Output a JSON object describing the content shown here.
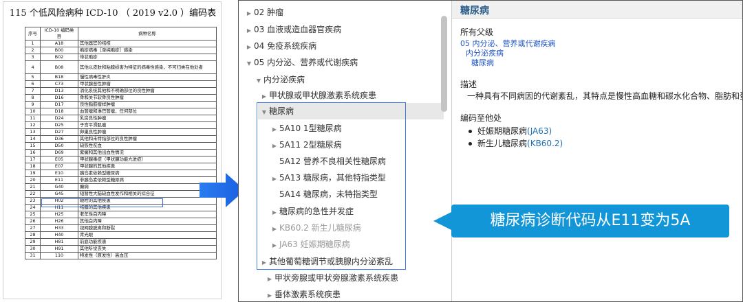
{
  "document": {
    "title": "115 个低风险病种 ICD-10 （ 2019 v2.0 ）编码表",
    "headers": {
      "no": "序号",
      "code": "ICD-10 编码类 目",
      "name": "病种名称"
    },
    "rows": [
      {
        "no": "1",
        "code": "A18",
        "name": "其他器官的结核"
      },
      {
        "no": "2",
        "code": "B00",
        "name": "疱疹病毒［单纯疱疹］感染"
      },
      {
        "no": "3",
        "code": "B02",
        "name": "带状疱疹"
      },
      {
        "no": "4",
        "code": "B08",
        "name": "其他以皮肤和粘膜损害为特征的病毒性感染，不可归类在他处者"
      },
      {
        "no": "5",
        "code": "B18",
        "name": "慢性病毒性肝炎"
      },
      {
        "no": "6",
        "code": "C73",
        "name": "甲状腺恶性肿瘤"
      },
      {
        "no": "7",
        "code": "D13",
        "name": "消化系统其他和不明确部位的良性肿瘤"
      },
      {
        "no": "8",
        "code": "D16",
        "name": "骨和关节软骨良性肿瘤"
      },
      {
        "no": "9",
        "code": "D17",
        "name": "良性脂肪瘤样肿瘤"
      },
      {
        "no": "10",
        "code": "D18",
        "name": "血管瘤和淋巴管瘤，任何部位"
      },
      {
        "no": "11",
        "code": "D24",
        "name": "乳房良性肿瘤"
      },
      {
        "no": "12",
        "code": "D25",
        "name": "子宫平滑肌瘤"
      },
      {
        "no": "13",
        "code": "D27",
        "name": "卵巢良性肿瘤"
      },
      {
        "no": "14",
        "code": "D36",
        "name": "其他和未特指部位的良性肿瘤"
      },
      {
        "no": "15",
        "code": "D50",
        "name": "缺铁性贫血"
      },
      {
        "no": "16",
        "code": "D69",
        "name": "紫癜和其他出血性情况"
      },
      {
        "no": "17",
        "code": "E05",
        "name": "甲状腺毒症（甲状腺功能亢进症）"
      },
      {
        "no": "18",
        "code": "E07",
        "name": "甲状腺的其他疾患"
      },
      {
        "no": "19",
        "code": "E10",
        "name": "胰岛素依赖型糖尿病"
      },
      {
        "no": "20",
        "code": "E11",
        "name": "非胰岛素依赖型糖尿病"
      },
      {
        "no": "21",
        "code": "G40",
        "name": "癫痫"
      },
      {
        "no": "22",
        "code": "G45",
        "name": "短暂性大脑缺血性发作和相关的综合征"
      },
      {
        "no": "23",
        "code": "H02",
        "name": "眼睑的其他疾患"
      },
      {
        "no": "24",
        "code": "H11",
        "name": "结膜的其他疾患"
      },
      {
        "no": "25",
        "code": "H25",
        "name": "老年性白内障"
      },
      {
        "no": "26",
        "code": "H26",
        "name": "其他白内障"
      },
      {
        "no": "27",
        "code": "H33",
        "name": "视网膜脱离和断裂"
      },
      {
        "no": "28",
        "code": "H40",
        "name": "青光眼"
      },
      {
        "no": "29",
        "code": "H81",
        "name": "前庭功能疾患"
      },
      {
        "no": "30",
        "code": "H91",
        "name": "其他听觉丧失"
      },
      {
        "no": "31",
        "code": "110",
        "name": "特发性（原发性）高血压"
      }
    ]
  },
  "tree": {
    "items": [
      {
        "label": "02 肿瘤",
        "toggle": "collapsed"
      },
      {
        "label": "03 血液或造血器官疾病",
        "toggle": "collapsed"
      },
      {
        "label": "04 免疫系统疾病",
        "toggle": "collapsed"
      },
      {
        "label": "05 内分泌、营养或代谢疾病",
        "toggle": "expanded"
      },
      {
        "label": "内分泌疾病",
        "toggle": "expanded"
      },
      {
        "label": "甲状腺或甲状腺激素系统疾患",
        "toggle": "collapsed"
      },
      {
        "label": "糖尿病",
        "toggle": "expanded"
      },
      {
        "label": "5A10 1型糖尿病",
        "toggle": "collapsed"
      },
      {
        "label": "5A11 2型糖尿病",
        "toggle": "collapsed"
      },
      {
        "label": "5A12 营养不良相关性糖尿病",
        "toggle": "none"
      },
      {
        "label": "5A13 糖尿病，其他特指类型",
        "toggle": "collapsed"
      },
      {
        "label": "5A14 糖尿病，未特指类型",
        "toggle": "none"
      },
      {
        "label": "糖尿病的急性并发症",
        "toggle": "collapsed"
      },
      {
        "label": "KB60.2 新生儿糖尿病",
        "toggle": "collapsed"
      },
      {
        "label": "JA63 妊娠期糖尿病",
        "toggle": "collapsed"
      },
      {
        "label": "其他葡萄糖调节或胰腺内分泌紊乱",
        "toggle": "collapsed"
      },
      {
        "label": "甲状旁腺或甲状旁腺激素系统疾患",
        "toggle": "collapsed"
      },
      {
        "label": "垂体激素系统疾患",
        "toggle": "collapsed"
      }
    ]
  },
  "detail": {
    "title": "糖尿病",
    "parents_label": "所有父级",
    "parents": [
      "05 内分泌、营养或代谢疾病",
      "内分泌疾病",
      "糖尿病"
    ],
    "description_label": "描述",
    "description": "一种具有不同病因的代谢紊乱，其特点是慢性高血糖和碳水化合物、脂肪和蛋白质代谢",
    "coded_elsewhere_label": "编码至他处",
    "coded_elsewhere": [
      {
        "name": "妊娠期糖尿病",
        "code": "(JA63)"
      },
      {
        "name": "新生儿糖尿病",
        "code": "(KB60.2)"
      }
    ]
  },
  "callout": {
    "text": "糖尿病诊断代码从E11变为5A"
  },
  "colors": {
    "accent": "#1296d8",
    "highlight_border": "#3c7be8",
    "link": "#1f53c8"
  }
}
